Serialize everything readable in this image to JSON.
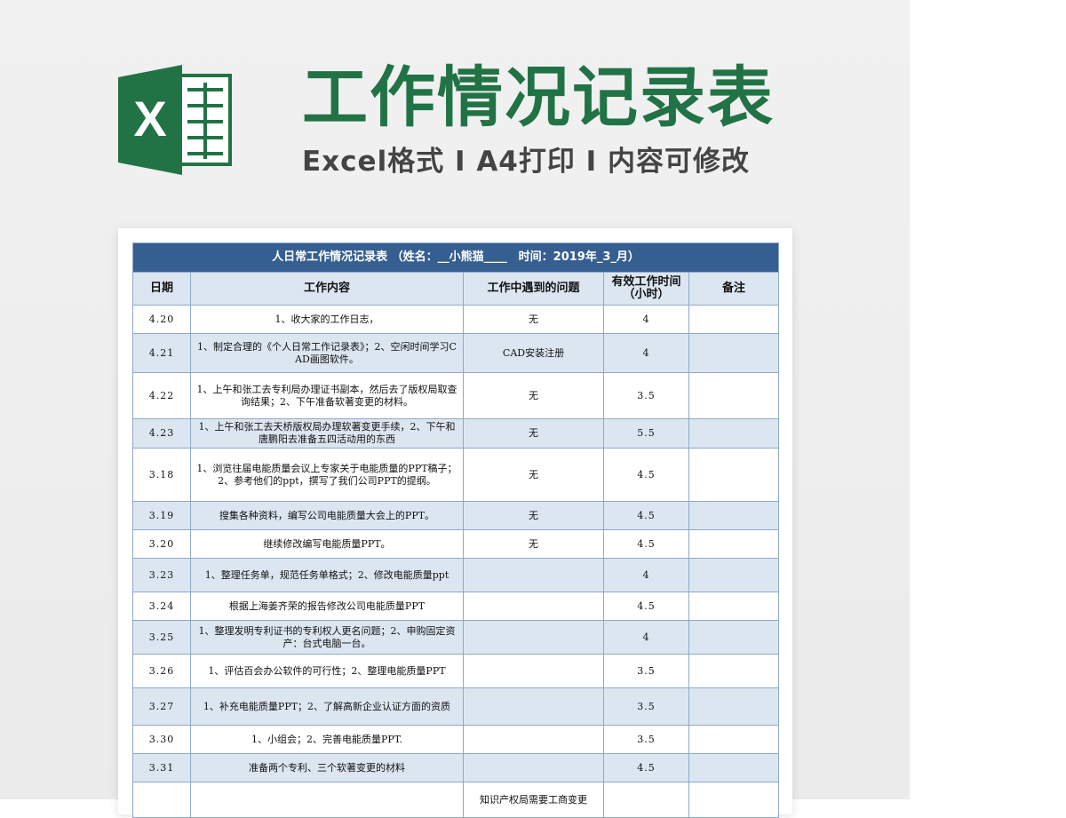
{
  "header": {
    "title": "工作情况记录表",
    "subtitle": "Excel格式 I A4打印 I 内容可修改",
    "logo_letter": "X",
    "logo_color": "#217346"
  },
  "sheet": {
    "caption": "人日常工作情况记录表 （姓名：__小熊猫____　时间：2019年_3_月）",
    "columns": [
      "日期",
      "工作内容",
      "工作中遇到的问题",
      "有效工作时间（小时）",
      "备注"
    ],
    "column_time_line1": "有效工作时间",
    "column_time_line2": "（小时）",
    "header_color": "#365f91",
    "stripe_color": "#dce6f1",
    "rows": [
      {
        "date": "4.20",
        "content": "1、收大家的工作日志，",
        "issue": "无",
        "hours": "4",
        "note": ""
      },
      {
        "date": "4.21",
        "content": "1、制定合理的《个人日常工作记录表》；2、空闲时间学习CAD画图软件。",
        "issue": "CAD安装注册",
        "hours": "4",
        "note": ""
      },
      {
        "date": "4.22",
        "content": "1、上午和张工去专利局办理证书副本，然后去了版权局取查询结果；2、下午准备软著变更的材料。",
        "issue": "无",
        "hours": "3.5",
        "note": ""
      },
      {
        "date": "4.23",
        "content": "1、上午和张工去天桥版权局办理软著变更手续，2、下午和唐鹏阳去准备五四活动用的东西",
        "issue": "无",
        "hours": "5.5",
        "note": ""
      },
      {
        "date": "3.18",
        "content": "1、浏览往届电能质量会议上专家关于电能质量的PPT稿子；2、参考他们的ppt，撰写了我们公司PPT的提纲。",
        "issue": "无",
        "hours": "4.5",
        "note": ""
      },
      {
        "date": "3.19",
        "content": "搜集各种资料，编写公司电能质量大会上的PPT。",
        "issue": "无",
        "hours": "4.5",
        "note": ""
      },
      {
        "date": "3.20",
        "content": "继续修改编写电能质量PPT。",
        "issue": "无",
        "hours": "4.5",
        "note": ""
      },
      {
        "date": "3.23",
        "content": "1、整理任务单，规范任务单格式；2、修改电能质量ppt",
        "issue": "",
        "hours": "4",
        "note": ""
      },
      {
        "date": "3.24",
        "content": "根据上海姜齐荣的报告修改公司电能质量PPT",
        "issue": "",
        "hours": "4.5",
        "note": ""
      },
      {
        "date": "3.25",
        "content": "1、整理发明专利证书的专利权人更名问题；2、申购固定资产：台式电脑一台。",
        "issue": "",
        "hours": "4",
        "note": ""
      },
      {
        "date": "3.26",
        "content": "1、评估百会办公软件的可行性；2、整理电能质量PPT",
        "issue": "",
        "hours": "3.5",
        "note": ""
      },
      {
        "date": "3.27",
        "content": "1、补充电能质量PPT；2、了解高新企业认证方面的资质",
        "issue": "",
        "hours": "3.5",
        "note": ""
      },
      {
        "date": "3.30",
        "content": "1、小组会；2、完善电能质量PPT.",
        "issue": "",
        "hours": "3.5",
        "note": ""
      },
      {
        "date": "3.31",
        "content": "准备两个专利、三个软著变更的材料",
        "issue": "",
        "hours": "4.5",
        "note": ""
      },
      {
        "date": "",
        "content": "",
        "issue": "知识产权局需要工商变更",
        "hours": "",
        "note": ""
      }
    ]
  }
}
